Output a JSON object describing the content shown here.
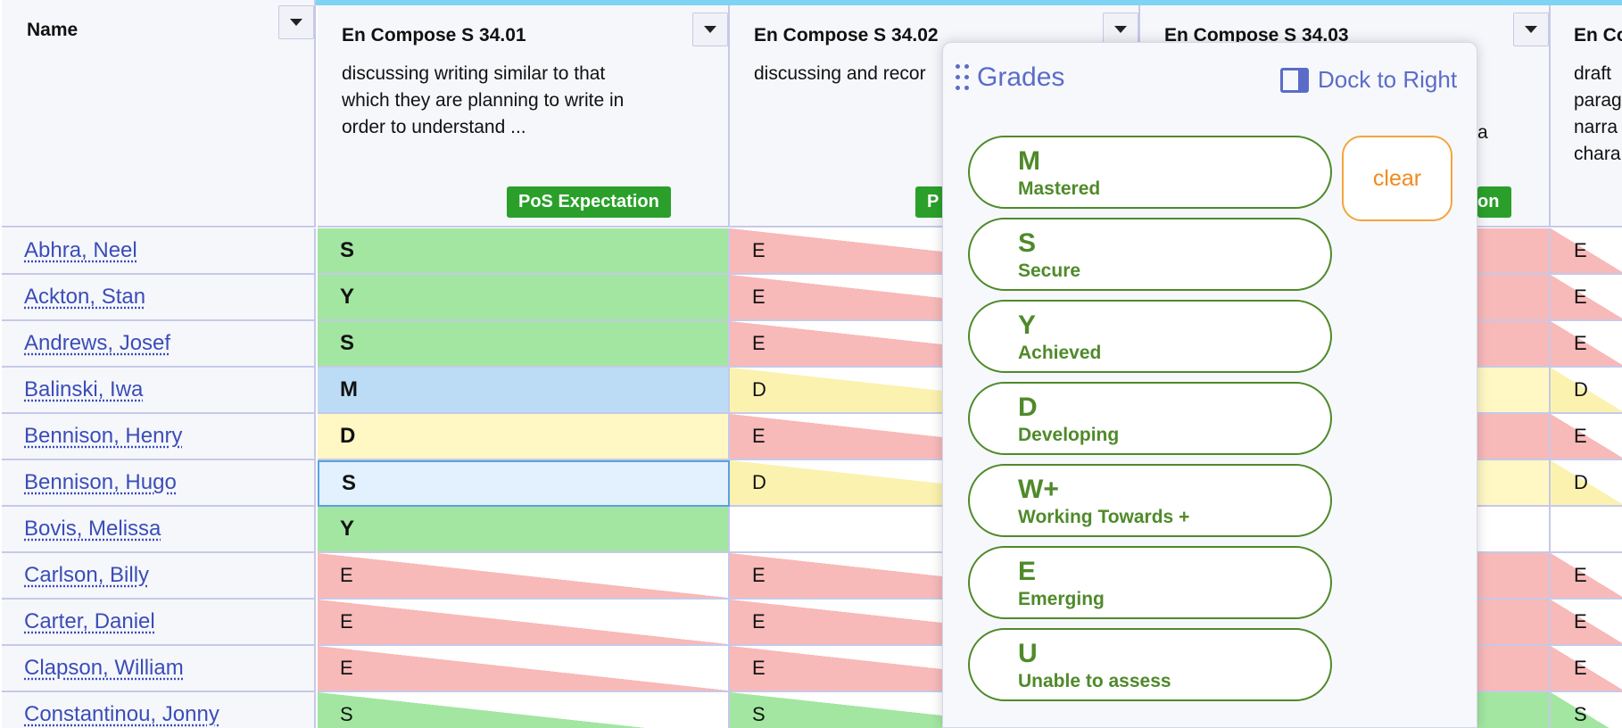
{
  "header": {
    "name_label": "Name",
    "columns": [
      {
        "title": "En Compose S 34.01",
        "desc": "discussing writing similar to that which they are planning to write in order to understand ...",
        "badge": "PoS Expectation"
      },
      {
        "title": "En Compose S 34.02",
        "desc": "discussing and recor",
        "badge": "P"
      },
      {
        "title": "En Compose S 34.03",
        "desc": "a",
        "badge": "on"
      },
      {
        "title": "En Co",
        "desc": "draft parag narra chara"
      }
    ]
  },
  "rows": [
    {
      "name": "Abhra, Neel",
      "cells": [
        "S",
        "E",
        "",
        "E"
      ]
    },
    {
      "name": "Ackton, Stan",
      "cells": [
        "Y",
        "E",
        "",
        "E"
      ]
    },
    {
      "name": "Andrews, Josef",
      "cells": [
        "S",
        "E",
        "",
        "E"
      ]
    },
    {
      "name": "Balinski, Iwa",
      "cells": [
        "M",
        "D",
        "",
        "D"
      ]
    },
    {
      "name": "Bennison, Henry",
      "cells": [
        "D",
        "E",
        "",
        "E"
      ]
    },
    {
      "name": "Bennison, Hugo",
      "cells": [
        "S",
        "D",
        "",
        "D"
      ]
    },
    {
      "name": "Bovis, Melissa",
      "cells": [
        "Y",
        "",
        "",
        ""
      ]
    },
    {
      "name": "Carlson, Billy",
      "cells": [
        "E",
        "E",
        "",
        "E"
      ]
    },
    {
      "name": "Carter, Daniel",
      "cells": [
        "E",
        "E",
        "",
        "E"
      ]
    },
    {
      "name": "Clapson, William",
      "cells": [
        "E",
        "E",
        "",
        "E"
      ]
    },
    {
      "name": "Constantinou, Jonny",
      "cells": [
        "S",
        "S",
        "",
        "S"
      ]
    }
  ],
  "panel": {
    "title": "Grades",
    "dock_label": "Dock to Right",
    "clear_label": "clear",
    "grades": [
      {
        "code": "M",
        "name": "Mastered"
      },
      {
        "code": "S",
        "name": "Secure"
      },
      {
        "code": "Y",
        "name": "Achieved"
      },
      {
        "code": "D",
        "name": "Developing"
      },
      {
        "code": "W+",
        "name": "Working Towards +"
      },
      {
        "code": "E",
        "name": "Emerging"
      },
      {
        "code": "U",
        "name": "Unable to assess"
      }
    ]
  },
  "colors": {
    "grade_green": "#4f8a2a",
    "accent_blue": "#5b6cc8",
    "clear_orange": "#f08a1c",
    "badge_green": "#2aa02a"
  }
}
